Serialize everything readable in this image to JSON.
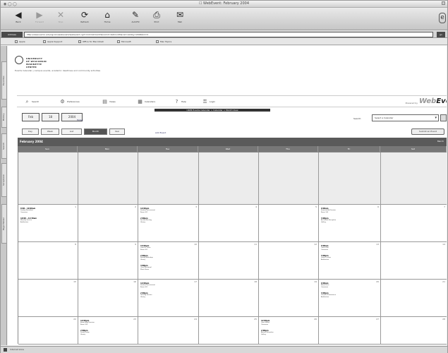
{
  "window": {
    "title": "☐ WebEvent: February 2004",
    "buttons": "◉ ◯ ◯"
  },
  "toolbar": [
    {
      "id": "back",
      "label": "Back",
      "icon": "◀",
      "dim": false
    },
    {
      "id": "forward",
      "label": "Forward",
      "icon": "▶",
      "dim": true
    },
    {
      "id": "stop",
      "label": "Stop",
      "icon": "✕",
      "dim": true
    },
    {
      "id": "refresh",
      "label": "Refresh",
      "icon": "⟳",
      "dim": false
    },
    {
      "id": "home",
      "label": "Home",
      "icon": "⌂",
      "dim": false
    },
    {
      "id": "autofill",
      "label": "AutoFill",
      "icon": "✎",
      "dim": false
    },
    {
      "id": "print",
      "label": "Print",
      "icon": "⎙",
      "dim": false
    },
    {
      "id": "mail",
      "label": "Mail",
      "icon": "✉",
      "dim": false
    }
  ],
  "toolbar_logo": "e",
  "address": {
    "label": "Address",
    "url": "http://www.uwmc.edu/cgi-bin/webevent/webevent.cgi?cmd=listmonth&ncmd=listmonth&cal=cal1&y=2004&m=2",
    "go": "go"
  },
  "favorites": [
    {
      "id": "apple",
      "label": "Apple"
    },
    {
      "id": "support",
      "label": "Apple Support"
    },
    {
      "id": "office",
      "label": "Office for Macintosh"
    },
    {
      "id": "ms",
      "label": "Microsoft"
    },
    {
      "id": "mac",
      "label": "Mac Topics"
    }
  ],
  "side_tabs": [
    "Favorites",
    "History",
    "Search",
    "Scrapbook",
    "Page Holder"
  ],
  "brand": {
    "name": "UNIVERSITY\nOF WISCONSIN\nMARINETTE\nCENTER",
    "sub": "Events Calendar   |   campus events, academic deadlines and community activities"
  },
  "nav": [
    {
      "id": "search",
      "label": "Search",
      "icon": "⌕"
    },
    {
      "id": "preferences",
      "label": "Preferences",
      "icon": "⚙"
    },
    {
      "id": "views",
      "label": "Views",
      "icon": "▤"
    },
    {
      "id": "calendars",
      "label": "Calendars",
      "icon": "▦"
    },
    {
      "id": "help",
      "label": "Help",
      "icon": "?"
    },
    {
      "id": "login",
      "label": "Login",
      "icon": "⚿"
    }
  ],
  "powered_by": "Powered by",
  "webevent_logo": {
    "a": "Web",
    "b": "Event"
  },
  "crumb": "UWM Events Calendar  >  Calendar  >  Month View",
  "date_boxes": [
    "Feb",
    "18",
    "2004"
  ],
  "today_link": "Today",
  "search_label": "Search:",
  "search_value": "Select a Calendar",
  "views": [
    {
      "id": "day",
      "label": "Day"
    },
    {
      "id": "week",
      "label": "Week"
    },
    {
      "id": "list",
      "label": "List"
    },
    {
      "id": "month",
      "label": "Month"
    },
    {
      "id": "year",
      "label": "Year"
    }
  ],
  "selected_view": "month",
  "add_link": "Add Event",
  "add_button": "Submit an Event",
  "cal": {
    "month": "February 2004",
    "next": "March"
  },
  "days": [
    "Sun",
    "Mon",
    "Tue",
    "Wed",
    "Thu",
    "Fri",
    "Sat"
  ],
  "weeks": [
    [
      "",
      "",
      "",
      "",
      "",
      "",
      ""
    ],
    [
      "1",
      "2",
      "3",
      "4",
      "5",
      "6",
      "7"
    ],
    [
      "8",
      "9",
      "10",
      "11",
      "12",
      "13",
      "14"
    ],
    [
      "15",
      "16",
      "17",
      "18",
      "19",
      "20",
      "21"
    ],
    [
      "22",
      "23",
      "24",
      "25",
      "26",
      "27",
      "28"
    ]
  ],
  "events": [
    {
      "w": 1,
      "d": 0,
      "items": [
        {
          "t": "8:00 - 10:00am",
          "l": "Sunday Breakfast",
          "s": "Commons"
        },
        {
          "t": "10:00 - 11:30am",
          "l": "Worship Service",
          "s": "Auditorium"
        }
      ]
    },
    {
      "w": 1,
      "d": 2,
      "items": [
        {
          "t": "12:00pm",
          "l": "Student Government",
          "s": "Room 201"
        },
        {
          "t": "2:00pm",
          "l": "Faculty Meeting",
          "s": "Library"
        }
      ]
    },
    {
      "w": 1,
      "d": 5,
      "items": [
        {
          "t": "9:00am",
          "l": "Financial Aid Session",
          "s": "Room 105"
        },
        {
          "t": "3:00pm",
          "l": "Art Exhibit Reception",
          "s": "Gallery"
        }
      ]
    },
    {
      "w": 2,
      "d": 2,
      "items": [
        {
          "t": "12:00pm",
          "l": "Lunch & Learn",
          "s": "Room 201"
        },
        {
          "t": "2:00pm",
          "l": "Writing Workshop",
          "s": "Library"
        },
        {
          "t": "4:00pm",
          "l": "Choir Rehearsal",
          "s": "Music Room"
        }
      ]
    },
    {
      "w": 2,
      "d": 5,
      "items": [
        {
          "t": "9:00am",
          "l": "Career Fair",
          "s": "Commons"
        },
        {
          "t": "3:00pm",
          "l": "Guest Lecture",
          "s": "Auditorium"
        }
      ]
    },
    {
      "w": 3,
      "d": 2,
      "items": [
        {
          "t": "12:00pm",
          "l": "Student Government",
          "s": "Room 201"
        },
        {
          "t": "2:00pm",
          "l": "Tutoring Session",
          "s": "Library"
        }
      ]
    },
    {
      "w": 3,
      "d": 5,
      "items": [
        {
          "t": "9:00am",
          "l": "Blood Drive",
          "s": "Commons"
        },
        {
          "t": "3:00pm",
          "l": "Theatre Performance",
          "s": "Auditorium"
        }
      ]
    },
    {
      "w": 4,
      "d": 1,
      "items": [
        {
          "t": "12:00pm",
          "l": "Brown Bag Seminar",
          "s": "Room 105"
        },
        {
          "t": "2:00pm",
          "l": "Study Group",
          "s": "Library"
        }
      ]
    },
    {
      "w": 4,
      "d": 4,
      "items": [
        {
          "t": "12:00pm",
          "l": "Open House",
          "s": "Commons"
        },
        {
          "t": "2:00pm",
          "l": "Alumni Reception",
          "s": "Gallery"
        }
      ]
    }
  ],
  "status": "Internet zone"
}
